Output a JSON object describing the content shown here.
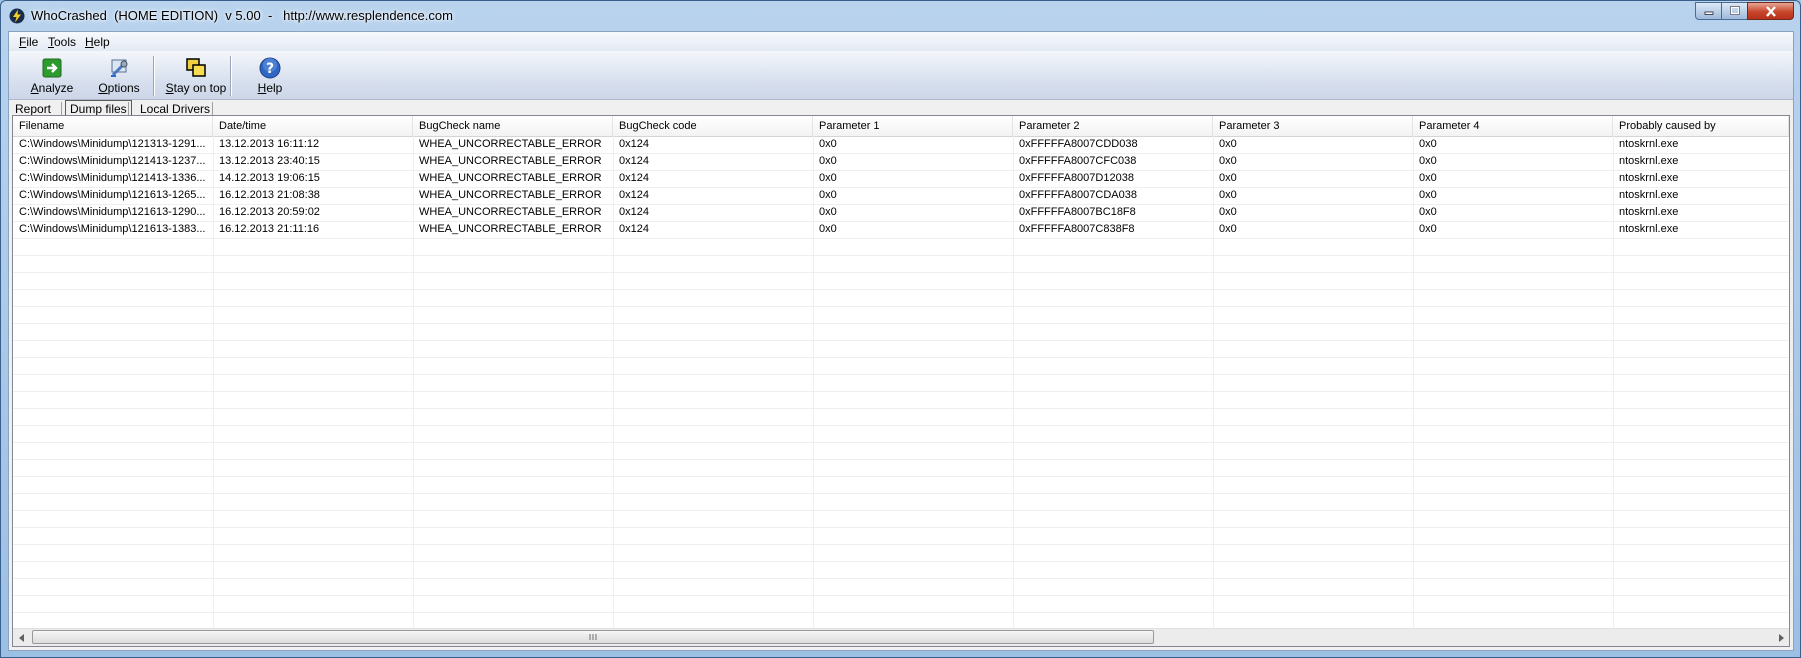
{
  "window": {
    "title": "WhoCrashed  (HOME EDITION)  v 5.00  -   http://www.resplendence.com"
  },
  "menu": {
    "items": [
      {
        "label": "File",
        "accel": "F",
        "rest": "ile"
      },
      {
        "label": "Tools",
        "accel": "T",
        "rest": "ools"
      },
      {
        "label": "Help",
        "accel": "H",
        "rest": "elp"
      }
    ]
  },
  "toolbar": {
    "analyze": {
      "accel": "A",
      "rest": "nalyze",
      "icon": "analyze-arrow-icon"
    },
    "options": {
      "accel": "O",
      "rest": "ptions",
      "icon": "options-tools-icon"
    },
    "stay_on_top": {
      "accel": "S",
      "rest": "tay on top",
      "icon": "stay-on-top-windows-icon"
    },
    "help": {
      "accel": "H",
      "rest": "elp",
      "icon": "help-question-icon"
    }
  },
  "tabs": [
    {
      "label": "Report",
      "active": false
    },
    {
      "label": "Dump files",
      "active": true
    },
    {
      "label": "Local Drivers",
      "active": false
    }
  ],
  "table": {
    "columns": [
      "Filename",
      "Date/time",
      "BugCheck name",
      "BugCheck code",
      "Parameter 1",
      "Parameter 2",
      "Parameter 3",
      "Parameter 4",
      "Probably caused by"
    ],
    "rows": [
      [
        "C:\\Windows\\Minidump\\121313-1291...",
        "13.12.2013 16:11:12",
        "WHEA_UNCORRECTABLE_ERROR",
        "0x124",
        "0x0",
        "0xFFFFFA8007CDD038",
        "0x0",
        "0x0",
        "ntoskrnl.exe"
      ],
      [
        "C:\\Windows\\Minidump\\121413-1237...",
        "13.12.2013 23:40:15",
        "WHEA_UNCORRECTABLE_ERROR",
        "0x124",
        "0x0",
        "0xFFFFFA8007CFC038",
        "0x0",
        "0x0",
        "ntoskrnl.exe"
      ],
      [
        "C:\\Windows\\Minidump\\121413-1336...",
        "14.12.2013 19:06:15",
        "WHEA_UNCORRECTABLE_ERROR",
        "0x124",
        "0x0",
        "0xFFFFFA8007D12038",
        "0x0",
        "0x0",
        "ntoskrnl.exe"
      ],
      [
        "C:\\Windows\\Minidump\\121613-1265...",
        "16.12.2013 21:08:38",
        "WHEA_UNCORRECTABLE_ERROR",
        "0x124",
        "0x0",
        "0xFFFFFA8007CDA038",
        "0x0",
        "0x0",
        "ntoskrnl.exe"
      ],
      [
        "C:\\Windows\\Minidump\\121613-1290...",
        "16.12.2013 20:59:02",
        "WHEA_UNCORRECTABLE_ERROR",
        "0x124",
        "0x0",
        "0xFFFFFA8007BC18F8",
        "0x0",
        "0x0",
        "ntoskrnl.exe"
      ],
      [
        "C:\\Windows\\Minidump\\121613-1383...",
        "16.12.2013 21:11:16",
        "WHEA_UNCORRECTABLE_ERROR",
        "0x124",
        "0x0",
        "0xFFFFFA8007C838F8",
        "0x0",
        "0x0",
        "ntoskrnl.exe"
      ]
    ]
  },
  "colors": {
    "title_bar": "#9cbfe4",
    "close_button": "#c7462b",
    "analyze_icon": "#2e9b2e",
    "help_icon": "#2f66c4"
  }
}
